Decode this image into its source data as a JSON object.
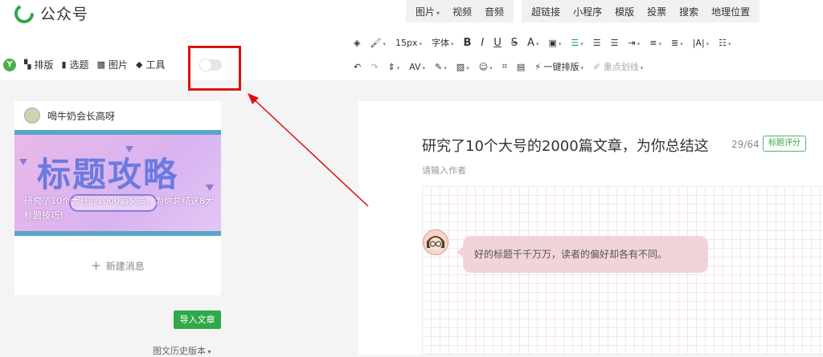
{
  "app": {
    "logo_text": "公众号"
  },
  "topnav": {
    "group1": [
      "图片",
      "视频",
      "音频"
    ],
    "group2": [
      "超链接",
      "小程序",
      "模版",
      "投票",
      "搜索",
      "地理位置"
    ]
  },
  "format_toolbar": {
    "font_size": "15px",
    "font_family": "字体",
    "bold": "B",
    "italic": "I",
    "underline": "U",
    "strike": "S",
    "font_color": "A",
    "one_click_layout": "一键排版",
    "key_line": "重点划线"
  },
  "left_tools": {
    "layout": "排版",
    "topics": "选题",
    "image": "图片",
    "tools": "工具"
  },
  "card": {
    "author": "喝牛奶会长高呀",
    "cover_title": "标题攻略",
    "cover_desc": "研究了10个大号的2000篇文章，为你总结这8大标题技巧！",
    "new_message": "新建消息"
  },
  "buttons": {
    "import": "导入文章",
    "history": "图文历史版本"
  },
  "editor": {
    "title": "研究了10个大号的2000篇文章，为你总结这",
    "counter": "29/64",
    "score_button": "标题评分",
    "author_placeholder": "请输入作者",
    "bubble_text": "好的标题千千万万，读者的偏好却各有不同。"
  },
  "colors": {
    "accent_green": "#2fa94a",
    "highlight_red": "#e01010"
  }
}
